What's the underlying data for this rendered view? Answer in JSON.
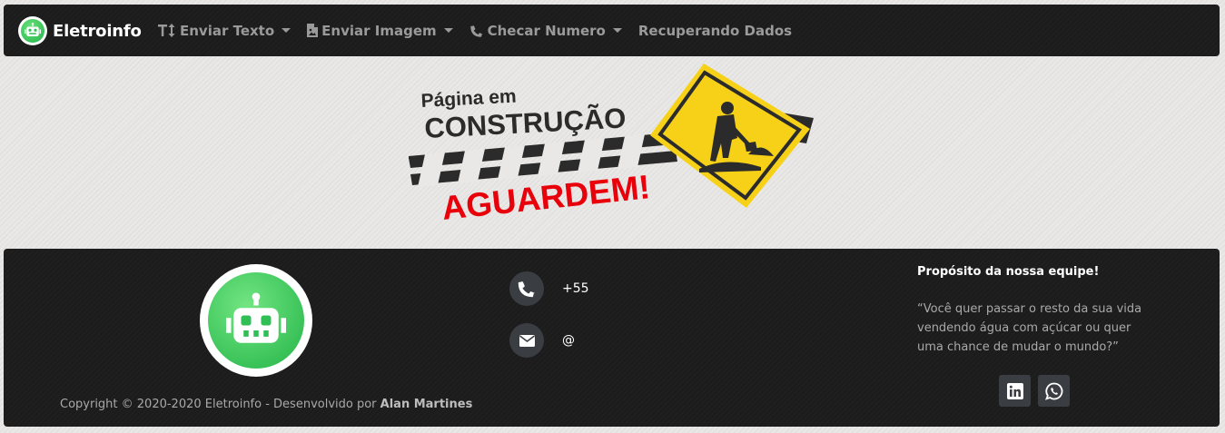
{
  "navbar": {
    "brand": "Eletroinfo",
    "items": [
      {
        "label": "Enviar Texto",
        "icon": "text-height-icon",
        "dropdown": true
      },
      {
        "label": "Enviar Imagem",
        "icon": "file-image-icon",
        "dropdown": true
      },
      {
        "label": "Checar Numero",
        "icon": "phone-icon",
        "dropdown": true
      },
      {
        "label": "Recuperando Dados",
        "dropdown": false
      }
    ]
  },
  "construction": {
    "line1": "Página em",
    "line2": "CONSTRUÇÃO",
    "line3": "AGUARDEM!"
  },
  "footer": {
    "copyright_prefix": "Copyright © 2020-2020 Eletroinfo - Desenvolvido por ",
    "copyright_author": "Alan Martines",
    "phone": "+55",
    "email": "@",
    "about_title": "Propósito da nossa equipe!",
    "about_text": "“Você quer passar o resto da sua vida vendendo água com açúcar ou quer uma chance de mudar o mundo?”",
    "social": [
      "linkedin-icon",
      "whatsapp-icon"
    ]
  },
  "colors": {
    "bar_bg": "#1c1c1c",
    "page_bg": "#e9e8e6",
    "logo_green": "#2fbf55",
    "nav_text": "#9a9a9a",
    "warning_yellow": "#f7d117",
    "warning_red": "#e8000b"
  }
}
